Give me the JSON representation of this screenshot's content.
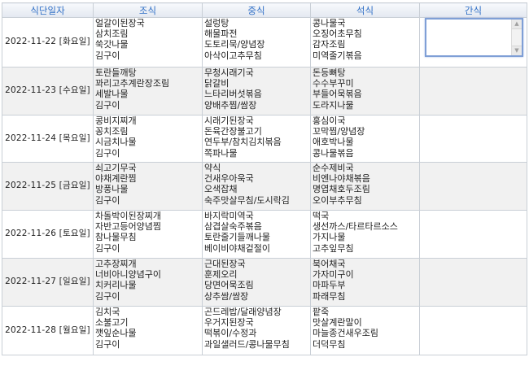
{
  "headers": [
    "식단일자",
    "조식",
    "중식",
    "석식",
    "간식"
  ],
  "rows": [
    {
      "date": "2022-11-22 [화요일]",
      "breakfast": [
        "얼갈이된장국",
        "삼치조림",
        "쑥갓나물",
        "김구이"
      ],
      "lunch": [
        "설렁탕",
        "해물파전",
        "도토리묵/양념장",
        "아삭이고추무침"
      ],
      "dinner": [
        "콩나물국",
        "오징어초무침",
        "감자조림",
        "미역줄기볶음"
      ],
      "snack": ""
    },
    {
      "date": "2022-11-23 [수요일]",
      "breakfast": [
        "토란들깨탕",
        "꽈리고추계란장조림",
        "세발나물",
        "김구이"
      ],
      "lunch": [
        "무청시래기국",
        "닭갈비",
        "느타리버섯볶음",
        "양배추찜/쌈장"
      ],
      "dinner": [
        "돈등뼈탕",
        "수수부꾸미",
        "부들어묵볶음",
        "도라지나물"
      ],
      "snack": ""
    },
    {
      "date": "2022-11-24 [목요일]",
      "breakfast": [
        "콩비지찌개",
        "꽁치조림",
        "시금치나물",
        "김구이"
      ],
      "lunch": [
        "시래기된장국",
        "돈육간장불고기",
        "연두부/참치김치볶음",
        "쪽파나물"
      ],
      "dinner": [
        "홍심이국",
        "꼬막찜/양념장",
        "애호박나물",
        "콩나물볶음"
      ],
      "snack": ""
    },
    {
      "date": "2022-11-25 [금요일]",
      "breakfast": [
        "쇠고기무국",
        "야채계란찜",
        "방풍나물",
        "김구이"
      ],
      "lunch": [
        "약식",
        "건새우아욱국",
        "오색잡채",
        "숙주맛살무침/도시락김"
      ],
      "dinner": [
        "순수제비국",
        "비엔나야채볶음",
        "명엽채호두조림",
        "오이부추무침"
      ],
      "snack": ""
    },
    {
      "date": "2022-11-26 [토요일]",
      "breakfast": [
        "차돌박이된장찌개",
        "자반고등어양념찜",
        "참나물무침",
        "김구이"
      ],
      "lunch": [
        "바지락미역국",
        "삼겹살숙주볶음",
        "토란줄기들깨나물",
        "베이비야채겉절이"
      ],
      "dinner": [
        "떡국",
        "생선까스/타르타르소스",
        "가지나물",
        "고추잎무침"
      ],
      "snack": ""
    },
    {
      "date": "2022-11-27 [일요일]",
      "breakfast": [
        "고추장찌개",
        "너비아니양념구이",
        "치커리나물",
        "김구이"
      ],
      "lunch": [
        "근대된장국",
        "훈제오리",
        "당면어묵조림",
        "상추쌈/쌈장"
      ],
      "dinner": [
        "북어채국",
        "가자미구이",
        "마파두부",
        "파래무침"
      ],
      "snack": ""
    },
    {
      "date": "2022-11-28 [월요일]",
      "breakfast": [
        "김치국",
        "소불고기",
        "깻잎순나물",
        "김구이"
      ],
      "lunch": [
        "곤드레밥/달래양념장",
        "우거지된장국",
        "떡볶이/수정과",
        "과일샐러드/콩나물무침"
      ],
      "dinner": [
        "팥죽",
        "맛살계란말이",
        "마늘종건새우조림",
        "더덕무침"
      ],
      "snack": ""
    }
  ]
}
